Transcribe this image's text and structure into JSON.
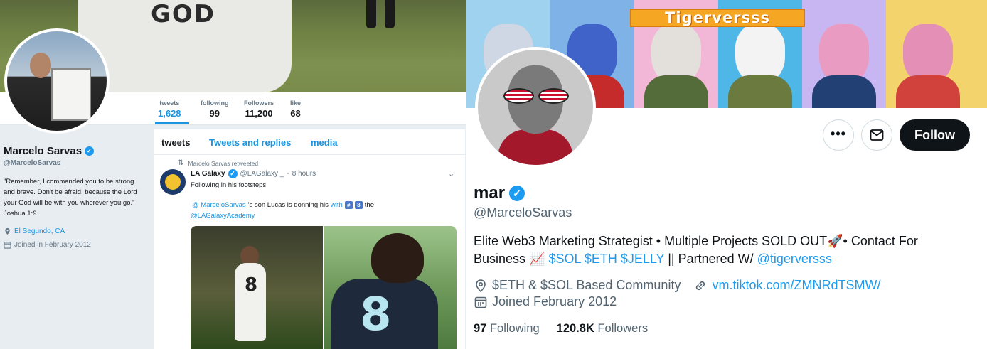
{
  "left": {
    "banner_text": "GOD",
    "stats": [
      {
        "label": "tweets",
        "value": "1,628"
      },
      {
        "label": "following",
        "value": "99"
      },
      {
        "label": "Followers",
        "value": "11,200"
      },
      {
        "label": "like",
        "value": "68"
      }
    ],
    "profile": {
      "name": "Marcelo Sarvas",
      "handle": "@MarceloSarvas _",
      "bio": "\"Remember, I commanded you to be strong and brave. Don't be afraid, because the Lord your God will be with you wherever you go.\" Joshua 1:9",
      "location": "El Segundo, CA",
      "joined": "Joined in February 2012"
    },
    "tabs": [
      "tweets",
      "Tweets and replies",
      "media"
    ],
    "tweet": {
      "retweet_note": "Marcelo Sarvas retweeted",
      "author_name": "LA Galaxy",
      "author_handle": "@LAGalaxy _",
      "separator": "·",
      "time": "8 hours",
      "text1": "Following in his footsteps.",
      "mention1": "@ MarceloSarvas",
      "text2": "'s son Lucas is donning his",
      "with_word": "with",
      "keycap1": "#",
      "keycap2": "8",
      "text3": "the",
      "mention2": "@LAGalaxyAcademy",
      "media_a_number": "8",
      "media_b_number": "8"
    }
  },
  "right": {
    "banner_title": "Tigerversss",
    "follow_label": "Follow",
    "more_label": "•••",
    "name": "mar",
    "handle": "@MarceloSarvas",
    "bio_part1": "Elite Web3 Marketing Strategist • Multiple Projects SOLD OUT🚀• Contact For Business 📈 ",
    "bio_tags": "$SOL $ETH $JELLY",
    "bio_part2": " || Partnered W/ ",
    "bio_mention": "@tigerversss",
    "location": "$ETH & $SOL Based Community",
    "link": "vm.tiktok.com/ZMNRdTSMW/",
    "joined": "Joined February 2012",
    "following_count": "97",
    "following_label": "Following",
    "followers_count": "120.8K",
    "followers_label": "Followers"
  },
  "colors": {
    "accent": "#1d9bf0",
    "old_accent": "#1b95e0",
    "follow_bg": "#0f1419",
    "banner_title_bg": "#f5a623"
  },
  "icons": [
    "verified-badge-icon",
    "location-pin-icon",
    "calendar-icon",
    "retweet-icon",
    "chevron-down-icon",
    "more-icon",
    "mail-icon",
    "link-icon"
  ]
}
